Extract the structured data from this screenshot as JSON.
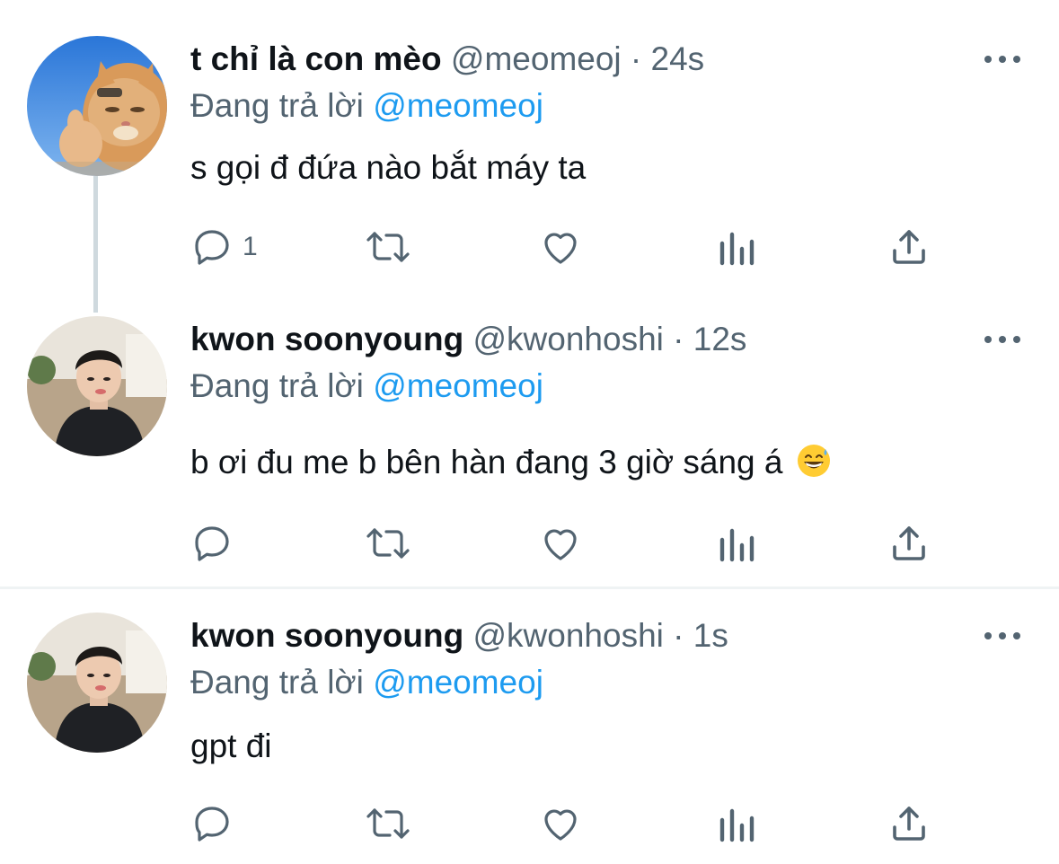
{
  "tweets": [
    {
      "display_name": "t chỉ là con mèo",
      "handle": "@meomeoj",
      "time": "· 24s",
      "replying_label": "Đang trả lời",
      "replying_to": "@meomeoj",
      "text": "s gọi đ đứa nào bắt máy ta",
      "reply_count": "1",
      "avatar": "cat-thumbs-up-avatar"
    },
    {
      "display_name": "kwon soonyoung",
      "handle": "@kwonhoshi",
      "time": "· 12s",
      "replying_label": "Đang trả lời",
      "replying_to": "@meomeoj",
      "text": "b ơi đu me b bên hàn đang 3 giờ sáng á",
      "emoji": "grinning-sweat-emoji",
      "reply_count": "",
      "avatar": "person-avatar"
    },
    {
      "display_name": "kwon soonyoung",
      "handle": "@kwonhoshi",
      "time": "· 1s",
      "replying_label": "Đang trả lời",
      "replying_to": "@meomeoj",
      "text": "gpt đi",
      "reply_count": "",
      "avatar": "person-avatar"
    }
  ],
  "colors": {
    "text": "#0f1419",
    "secondary": "#536471",
    "mention": "#1d9bf0",
    "thread_line": "#cfd9de",
    "divider": "#eff3f4"
  },
  "icons": [
    "reply-icon",
    "retweet-icon",
    "like-icon",
    "analytics-icon",
    "share-icon",
    "more-icon"
  ]
}
